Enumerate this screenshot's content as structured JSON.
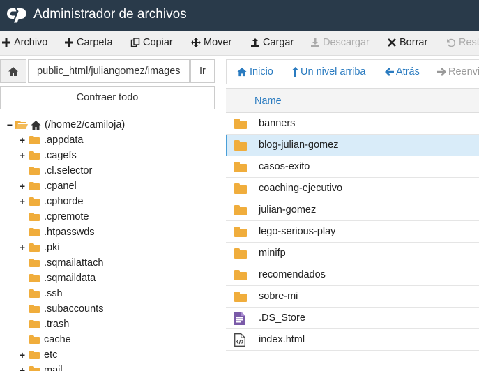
{
  "app": {
    "title": "Administrador de archivos"
  },
  "toolbar": {
    "archivo": "Archivo",
    "carpeta": "Carpeta",
    "copiar": "Copiar",
    "mover": "Mover",
    "cargar": "Cargar",
    "descargar": "Descargar",
    "borrar": "Borrar",
    "restaurar": "Resta"
  },
  "path": {
    "value": "public_html/juliangomez/images",
    "go_label": "Ir"
  },
  "sidebar": {
    "collapse_label": "Contraer todo",
    "root": "(/home2/camiloja)",
    "items": [
      {
        "label": ".appdata",
        "toggle": "+"
      },
      {
        "label": ".cagefs",
        "toggle": "+"
      },
      {
        "label": ".cl.selector",
        "toggle": ""
      },
      {
        "label": ".cpanel",
        "toggle": "+"
      },
      {
        "label": ".cphorde",
        "toggle": "+"
      },
      {
        "label": ".cpremote",
        "toggle": ""
      },
      {
        "label": ".htpasswds",
        "toggle": ""
      },
      {
        "label": ".pki",
        "toggle": "+"
      },
      {
        "label": ".sqmailattach",
        "toggle": ""
      },
      {
        "label": ".sqmaildata",
        "toggle": ""
      },
      {
        "label": ".ssh",
        "toggle": ""
      },
      {
        "label": ".subaccounts",
        "toggle": ""
      },
      {
        "label": ".trash",
        "toggle": ""
      },
      {
        "label": "cache",
        "toggle": ""
      },
      {
        "label": "etc",
        "toggle": "+"
      },
      {
        "label": "mail",
        "toggle": "+"
      }
    ]
  },
  "nav": {
    "inicio": "Inicio",
    "nivel_arriba": "Un nivel arriba",
    "atras": "Atrás",
    "reenviar": "Reenvi"
  },
  "files": {
    "column_name": "Name",
    "rows": [
      {
        "name": "banners",
        "type": "folder"
      },
      {
        "name": "blog-julian-gomez",
        "type": "folder",
        "selected": true
      },
      {
        "name": "casos-exito",
        "type": "folder"
      },
      {
        "name": "coaching-ejecutivo",
        "type": "folder"
      },
      {
        "name": "julian-gomez",
        "type": "folder"
      },
      {
        "name": "lego-serious-play",
        "type": "folder"
      },
      {
        "name": "minifp",
        "type": "folder"
      },
      {
        "name": "recomendados",
        "type": "folder"
      },
      {
        "name": "sobre-mi",
        "type": "folder"
      },
      {
        "name": ".DS_Store",
        "type": "text-file"
      },
      {
        "name": "index.html",
        "type": "html-file"
      }
    ]
  },
  "colors": {
    "titlebar": "#293a4a",
    "link": "#2a7bc0",
    "folder": "#f0ad3c",
    "selected": "#d9ecf9"
  }
}
